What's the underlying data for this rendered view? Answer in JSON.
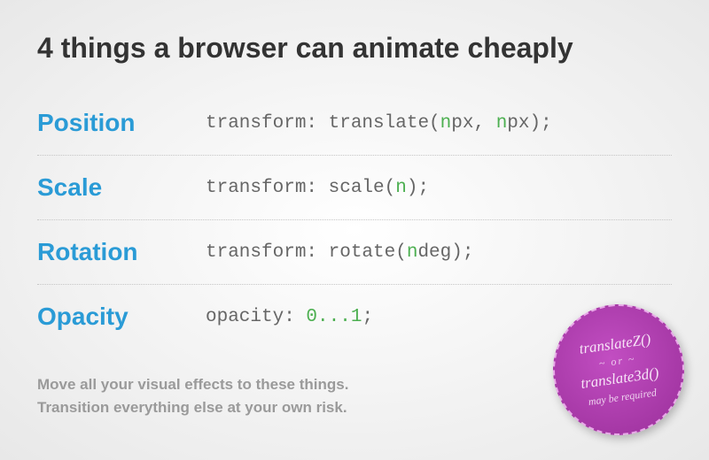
{
  "title": "4 things a browser can animate cheaply",
  "rows": [
    {
      "label": "Position",
      "code_parts": [
        "transform: translate(",
        "n",
        "px, ",
        "n",
        "px);"
      ]
    },
    {
      "label": "Scale",
      "code_parts": [
        "transform: scale(",
        "n",
        ");"
      ]
    },
    {
      "label": "Rotation",
      "code_parts": [
        "transform: rotate(",
        "n",
        "deg);"
      ]
    },
    {
      "label": "Opacity",
      "code_parts": [
        "opacity: ",
        "0...1",
        ";"
      ]
    }
  ],
  "footer": {
    "line1": "Move all your visual effects to these things.",
    "line2": "Transition everything else at your own risk."
  },
  "badge": {
    "line1": "translateZ()",
    "sep": "~ or ~",
    "line2": "translate3d()",
    "line3": "may be required"
  },
  "colors": {
    "label": "#2a9bd6",
    "code": "#666666",
    "accent_n": "#4caf50",
    "title": "#333333",
    "footer": "#9a9a9a",
    "badge_bg": "#9a2f9a"
  }
}
